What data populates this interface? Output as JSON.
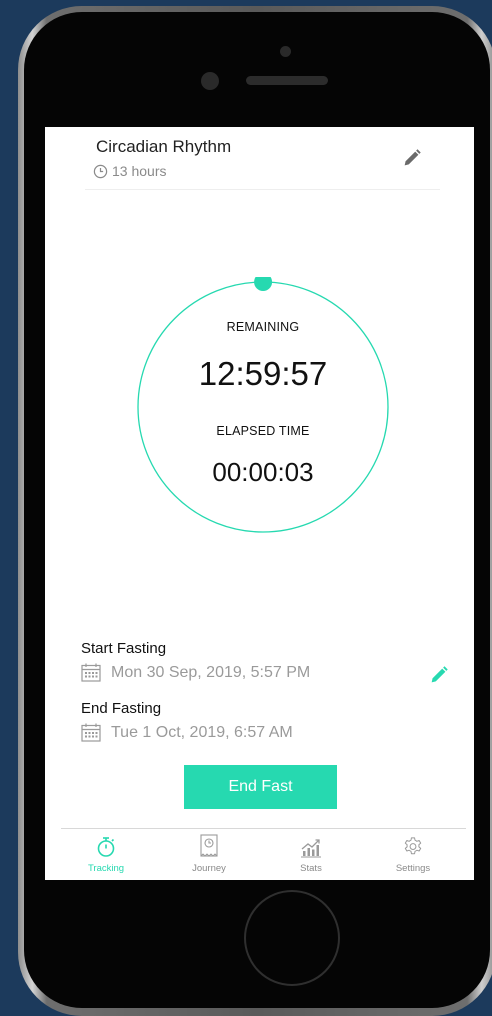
{
  "plan": {
    "name": "Circadian Rhythm",
    "duration": "13 hours"
  },
  "timer": {
    "remaining_label": "REMAINING",
    "remaining_value": "12:59:57",
    "elapsed_label": "ELAPSED TIME",
    "elapsed_value": "00:00:03",
    "progress_fraction": 0.0001
  },
  "schedule": {
    "start_label": "Start Fasting",
    "start_value": "Mon 30 Sep, 2019, 5:57 PM",
    "end_label": "End Fasting",
    "end_value": "Tue 1 Oct, 2019, 6:57 AM"
  },
  "action": {
    "end_fast_label": "End Fast"
  },
  "tabs": [
    {
      "label": "Tracking",
      "icon": "stopwatch-icon",
      "active": true
    },
    {
      "label": "Journey",
      "icon": "journey-icon",
      "active": false
    },
    {
      "label": "Stats",
      "icon": "stats-chart-icon",
      "active": false
    },
    {
      "label": "Settings",
      "icon": "gear-icon",
      "active": false
    }
  ],
  "colors": {
    "accent": "#26d9b0",
    "background": "#1c3a5c",
    "muted_text": "#9a9a9a"
  }
}
